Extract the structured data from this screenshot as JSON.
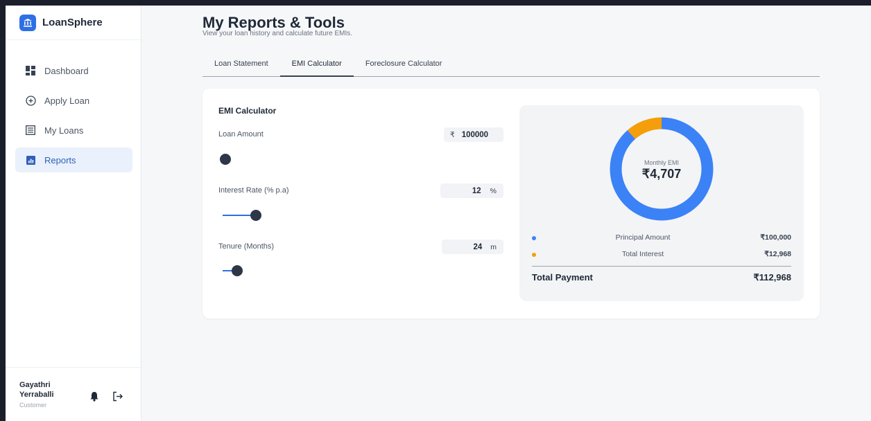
{
  "brand": {
    "name": "LoanSphere",
    "logo_icon": "bank-icon",
    "accent": "#2f6fe6"
  },
  "sidebar": {
    "items": [
      {
        "label": "Dashboard",
        "icon": "dashboard-icon",
        "active": false
      },
      {
        "label": "Apply Loan",
        "icon": "plus-circle-icon",
        "active": false
      },
      {
        "label": "My Loans",
        "icon": "list-icon",
        "active": false
      },
      {
        "label": "Reports",
        "icon": "chart-icon",
        "active": true
      }
    ]
  },
  "user": {
    "first_name": "Gayathri",
    "last_name": "Yerraballi",
    "role": "Customer"
  },
  "header": {
    "title": "My Reports & Tools",
    "subtitle": "View your loan history and calculate future EMIs."
  },
  "tabs": [
    {
      "label": "Loan Statement",
      "active": false
    },
    {
      "label": "EMI Calculator",
      "active": true
    },
    {
      "label": "Foreclosure Calculator",
      "active": false
    }
  ],
  "calculator": {
    "title": "EMI Calculator",
    "loan_amount": {
      "label": "Loan Amount",
      "prefix": "₹",
      "value": "100000",
      "slider_fraction": 0.0
    },
    "interest_rate": {
      "label": "Interest Rate (% p.a)",
      "value": "12",
      "suffix": "%",
      "slider_fraction": 0.12
    },
    "tenure": {
      "label": "Tenure (Months)",
      "value": "24",
      "suffix": "m",
      "slider_fraction": 0.05
    }
  },
  "summary": {
    "emi_label": "Monthly EMI",
    "emi_value": "₹4,707",
    "principal_label": "Principal Amount",
    "principal_value": "₹100,000",
    "principal_color": "#3b82f6",
    "interest_label": "Total Interest",
    "interest_value": "₹12,968",
    "interest_color": "#f59e0b",
    "total_label": "Total Payment",
    "total_value": "₹112,968",
    "principal_fraction": 0.885
  }
}
